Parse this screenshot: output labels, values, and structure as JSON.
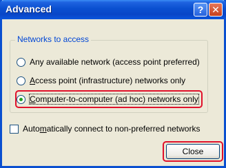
{
  "window": {
    "title": "Advanced",
    "help_glyph": "?",
    "close_glyph": "✕"
  },
  "networks_group": {
    "label": "Networks to access",
    "options": [
      {
        "pre": "",
        "accel": "",
        "label": "Any available network (access point preferred)",
        "selected": false
      },
      {
        "pre": "",
        "accel": "A",
        "label": "ccess point (infrastructure) networks only",
        "selected": false
      },
      {
        "pre": "",
        "accel": "C",
        "label": "omputer-to-computer (ad hoc) networks only",
        "selected": true
      }
    ]
  },
  "auto_connect": {
    "pre": "Auto",
    "accel": "m",
    "post": "atically connect to non-preferred networks",
    "checked": false
  },
  "buttons": {
    "close_label": "Close"
  },
  "colors": {
    "title_bar": "#0a4fd0",
    "group_label": "#0046d5",
    "highlight": "#e0102a",
    "dialog_bg": "#ece9d8"
  }
}
